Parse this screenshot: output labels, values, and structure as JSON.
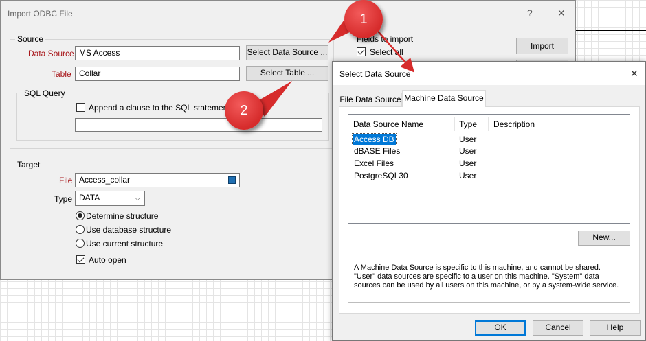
{
  "import_dialog": {
    "title": "Import ODBC File",
    "help_glyph": "?",
    "close_glyph": "✕",
    "source_group": "Source",
    "data_source_label": "Data Source",
    "data_source_value": "MS Access",
    "select_data_source_button": "Select Data Source ...",
    "table_label": "Table",
    "table_value": "Collar",
    "select_table_button": "Select  Table ...",
    "sql_query_group": "SQL Query",
    "append_clause_label": "Append a clause to the SQL statement",
    "sql_clause_value": "",
    "fields_to_import_label": "Fields to import",
    "select_all_label": "Select all",
    "import_button": "Import",
    "target_group": "Target",
    "file_label": "File",
    "file_value": "Access_collar",
    "type_label": "Type",
    "type_value": "DATA",
    "radio_determine": "Determine structure",
    "radio_database": "Use database structure",
    "radio_current": "Use current structure",
    "auto_open_label": "Auto open"
  },
  "select_ds_dialog": {
    "title": "Select Data Source",
    "close_glyph": "✕",
    "tabs": [
      "File Data Source",
      "Machine Data Source"
    ],
    "active_tab": "Machine Data Source",
    "columns": [
      "Data Source Name",
      "Type",
      "Description"
    ],
    "rows": [
      {
        "name": "Access DB",
        "type": "User",
        "description": "",
        "selected": true
      },
      {
        "name": "dBASE Files",
        "type": "User",
        "description": ""
      },
      {
        "name": "Excel Files",
        "type": "User",
        "description": ""
      },
      {
        "name": "PostgreSQL30",
        "type": "User",
        "description": ""
      }
    ],
    "new_button": "New...",
    "info_line1": "A Machine Data Source is specific to this machine, and cannot be shared.",
    "info_line2": "\"User\" data sources are specific to a user on this machine.  \"System\" data",
    "info_line3": "sources can be used by all users on this machine, or by a system-wide service.",
    "ok_button": "OK",
    "cancel_button": "Cancel",
    "help_button": "Help"
  },
  "callouts": [
    "1",
    "2"
  ],
  "colors": {
    "accent": "#0078d7",
    "required_label": "#a8161a",
    "callout": "#d62b2b",
    "file_swatch": "#1f6fb2"
  }
}
